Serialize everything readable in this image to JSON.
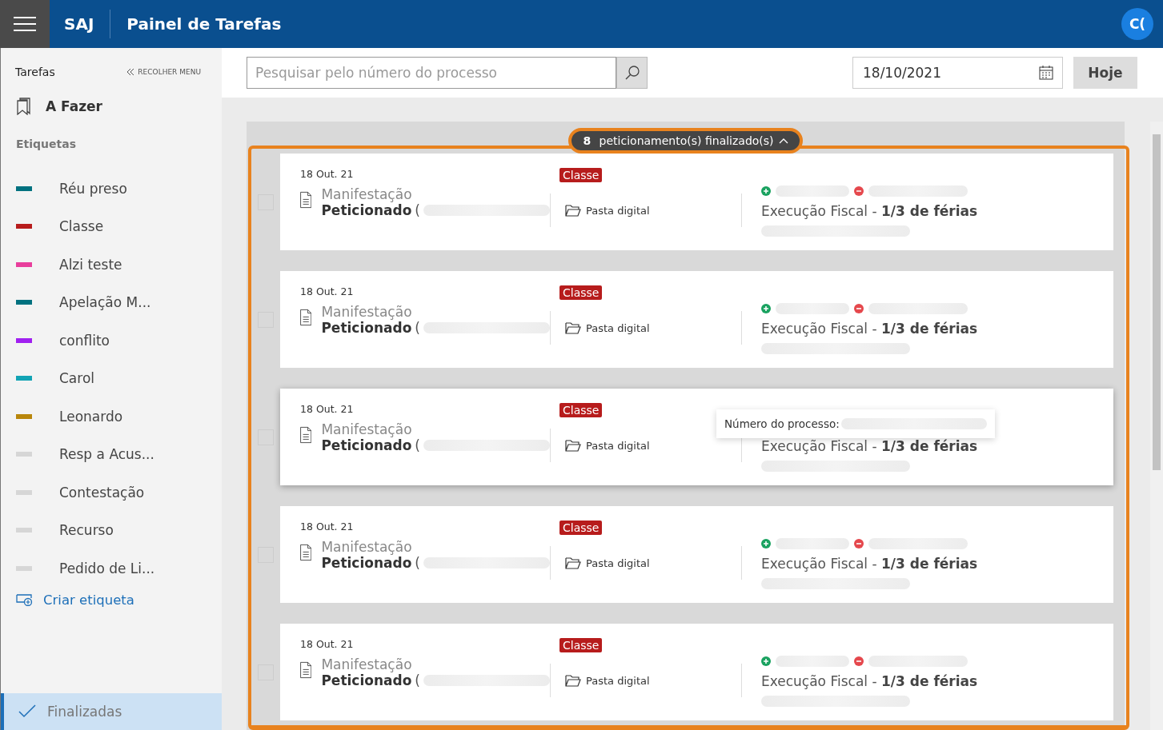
{
  "header": {
    "brand": "SAJ",
    "title": "Painel de Tarefas",
    "avatar": "C("
  },
  "sidebar": {
    "heading": "Tarefas",
    "collapse": "RECOLHER MENU",
    "todo": "A Fazer",
    "tags_heading": "Etiquetas",
    "tags": [
      {
        "label": "Réu preso",
        "color": "#00717f"
      },
      {
        "label": "Classe",
        "color": "#b71c1c"
      },
      {
        "label": "Alzi teste",
        "color": "#e83e9c"
      },
      {
        "label": "Apelação M...",
        "color": "#00717f"
      },
      {
        "label": "conflito",
        "color": "#a020f0"
      },
      {
        "label": "Carol",
        "color": "#12a3b4"
      },
      {
        "label": "Leonardo",
        "color": "#b8860b"
      },
      {
        "label": "Resp a Acus...",
        "color": "#d6d6d6"
      },
      {
        "label": "Contestação",
        "color": "#d6d6d6"
      },
      {
        "label": "Recurso",
        "color": "#d6d6d6"
      },
      {
        "label": "Pedido de Li...",
        "color": "#d6d6d6"
      }
    ],
    "create": "Criar etiqueta",
    "finished": {
      "label": "Finalizadas",
      "selected": true
    }
  },
  "search": {
    "placeholder": "Pesquisar pelo número do processo"
  },
  "date": {
    "value": "18/10/2021"
  },
  "today_button": "Hoje",
  "group": {
    "count": "8",
    "label": "peticionamento(s) finalizado(s)",
    "expanded": true
  },
  "cards": [
    {
      "date": "18 Out. 21",
      "tag": "Classe",
      "type": "Manifestação",
      "status": "Peticionado",
      "open_paren": "(",
      "folder": "Pasta digital",
      "subject": "Execução Fiscal -",
      "subject_detail": "1/3 de férias",
      "checked": false,
      "hover": false
    },
    {
      "date": "18 Out. 21",
      "tag": "Classe",
      "type": "Manifestação",
      "status": "Peticionado",
      "open_paren": "(",
      "folder": "Pasta digital",
      "subject": "Execução Fiscal -",
      "subject_detail": "1/3 de férias",
      "checked": false,
      "hover": false
    },
    {
      "date": "18 Out. 21",
      "tag": "Classe",
      "type": "Manifestação",
      "status": "Peticionado",
      "open_paren": "(",
      "folder": "Pasta digital",
      "subject": "Execução Fiscal -",
      "subject_detail": "1/3 de férias",
      "checked": false,
      "hover": true,
      "tooltip": "Número do processo:"
    },
    {
      "date": "18 Out. 21",
      "tag": "Classe",
      "type": "Manifestação",
      "status": "Peticionado",
      "open_paren": "(",
      "folder": "Pasta digital",
      "subject": "Execução Fiscal -",
      "subject_detail": "1/3 de férias",
      "checked": false,
      "hover": false
    },
    {
      "date": "18 Out. 21",
      "tag": "Classe",
      "type": "Manifestação",
      "status": "Peticionado",
      "open_paren": "(",
      "folder": "Pasta digital",
      "subject": "Execução Fiscal -",
      "subject_detail": "1/3 de férias",
      "checked": false,
      "hover": false
    }
  ]
}
